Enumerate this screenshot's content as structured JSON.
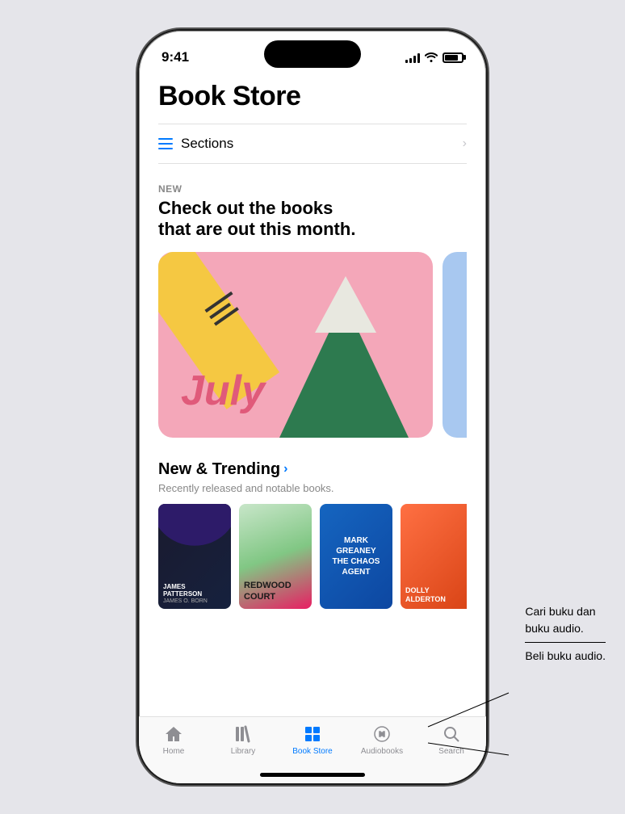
{
  "status": {
    "time": "9:41",
    "signal_bars": [
      3,
      5,
      8,
      11,
      14
    ],
    "wifi": "wifi",
    "battery": 80
  },
  "page": {
    "title": "Book Store"
  },
  "sections": {
    "label": "Sections",
    "chevron": "›"
  },
  "featured": {
    "label": "NEW",
    "title": "Check out the books\nthat are out this month.",
    "banner_month": "July"
  },
  "trending": {
    "title": "New & Trending",
    "arrow": "›",
    "subtitle": "Recently released and notable books.",
    "books": [
      {
        "author": "JAMES\nPATTERSON",
        "co_author": "JAMES O. BORN",
        "bg": "#1a1a2e"
      },
      {
        "title": "REDWOOD\nCOURT",
        "bg": "#c8e6c9"
      },
      {
        "title": "MARK\nGREANEY\nTHE CHAOS\nAGENT",
        "bg": "#1565c0"
      },
      {
        "title": "DOLLY\nALDERTON",
        "bg": "#ff7043"
      },
      {
        "title": "",
        "bg": "#795548"
      }
    ]
  },
  "tabs": [
    {
      "id": "home",
      "label": "Home",
      "active": false
    },
    {
      "id": "library",
      "label": "Library",
      "active": false
    },
    {
      "id": "bookstore",
      "label": "Book Store",
      "active": true
    },
    {
      "id": "audiobooks",
      "label": "Audiobooks",
      "active": false
    },
    {
      "id": "search",
      "label": "Search",
      "active": false
    }
  ],
  "annotations": {
    "line1": "Cari buku dan\nbuku audio.",
    "line2": "Beli buku audio."
  }
}
